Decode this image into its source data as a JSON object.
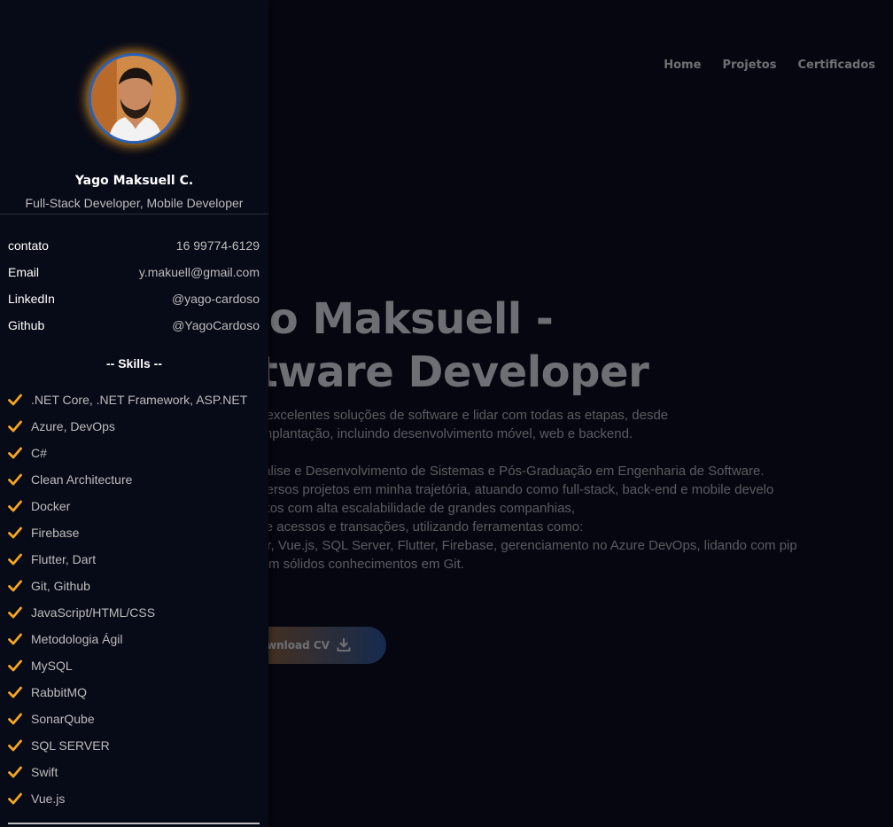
{
  "nav": {
    "items": [
      "Home",
      "Projetos",
      "Certificados"
    ]
  },
  "hero": {
    "title_line1": "ago Maksuell -",
    "title_line2": "oftware Developer",
    "description": [
      "paz de criar excelentes soluções de software e lidar com todas as etapas, desde",
      "ceito até a implantação, incluindo desenvolvimento móvel, web e backend.",
      "",
      "ação em Análise e Desenvolvimento de Sistemas e Pós-Graduação em Engenharia de Software.",
      "ticipei de diversos projetos em minha trajetória, atuando como full-stack, back-end e mobile develo",
      "hei em projetos com alta escalabilidade de grandes companhias,",
      "ande fluxo de acessos e transações, utilizando ferramentas como:",
      "Core, Docker, Vue.js, SQL Server, Flutter, Firebase, gerenciamento no Azure DevOps, lidando com pip",
      "oy CI/CD, com sólidos conhecimentos em Git."
    ],
    "cv_button_label": "ownload CV",
    "cv_button_icon": "download-icon"
  },
  "sidebar": {
    "name": "Yago Maksuell C.",
    "role": "Full-Stack Developer, Mobile Developer",
    "contacts": [
      {
        "key": "contato",
        "value": "16 99774-6129"
      },
      {
        "key": "Email",
        "value": "y.makuell@gmail.com"
      },
      {
        "key": "LinkedIn",
        "value": "@yago-cardoso"
      },
      {
        "key": "Github",
        "value": "@YagoCardoso"
      }
    ],
    "skills_title": "-- Skills --",
    "skills": [
      ".NET Core, .NET Framework, ASP.NET",
      "Azure, DevOps",
      "C#",
      "Clean Architecture",
      "Docker",
      "Firebase",
      "Flutter, Dart",
      "Git, Github",
      "JavaScript/HTML/CSS",
      "Metodologia Ágil",
      "MySQL",
      "RabbitMQ",
      "SonarQube",
      "SQL SERVER",
      "Swift",
      "Vue.js"
    ],
    "check_icon": "check-icon"
  },
  "colors": {
    "background": "#05060f",
    "sidebar_bg": "#070a17",
    "accent_orange": "#f5a623",
    "accent_blue": "#2a62b8",
    "muted_text": "#bdbdbd"
  }
}
